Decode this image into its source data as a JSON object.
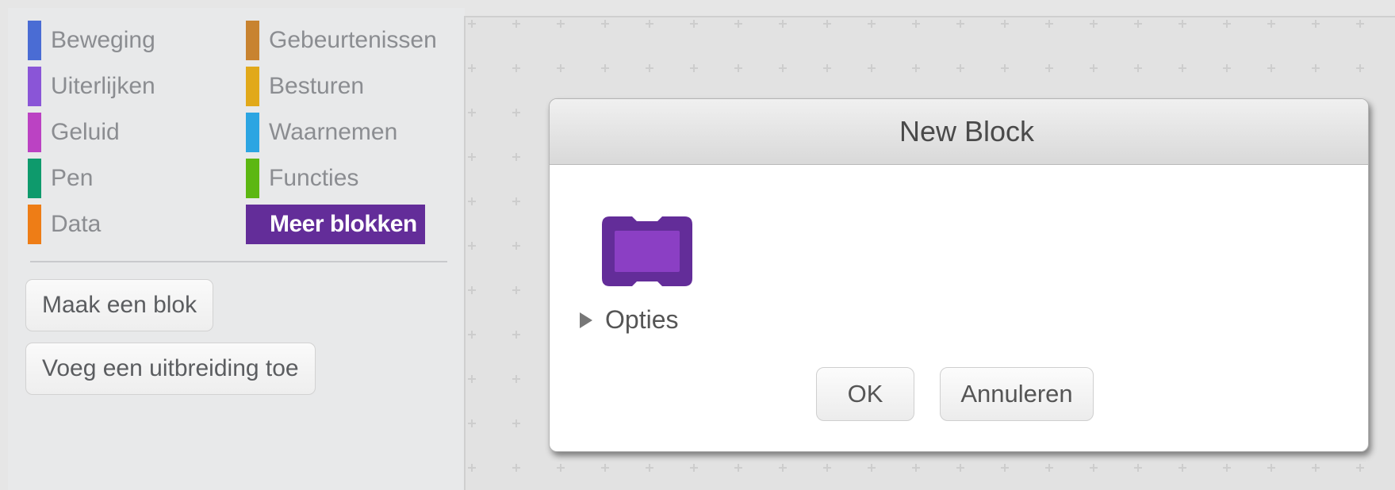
{
  "palette": {
    "categories": [
      {
        "label": "Beweging",
        "color": "#4a6cd4"
      },
      {
        "label": "Uiterlijken",
        "color": "#8a55d7"
      },
      {
        "label": "Geluid",
        "color": "#bb42c3"
      },
      {
        "label": "Pen",
        "color": "#0e9a6c"
      },
      {
        "label": "Data",
        "color": "#ee7d16"
      },
      {
        "label": "Gebeurtenissen",
        "color": "#c88330"
      },
      {
        "label": "Besturen",
        "color": "#e1a91a"
      },
      {
        "label": "Waarnemen",
        "color": "#2ca5e2"
      },
      {
        "label": "Functies",
        "color": "#5cb712"
      },
      {
        "label": "Meer blokken",
        "color": "#632d99"
      }
    ],
    "selected": "Meer blokken",
    "make_block_label": "Maak een blok",
    "add_extension_label": "Voeg een uitbreiding toe"
  },
  "dialog": {
    "title": "New Block",
    "options_label": "Opties",
    "ok_label": "OK",
    "cancel_label": "Annuleren",
    "block_color": "#632d99"
  }
}
